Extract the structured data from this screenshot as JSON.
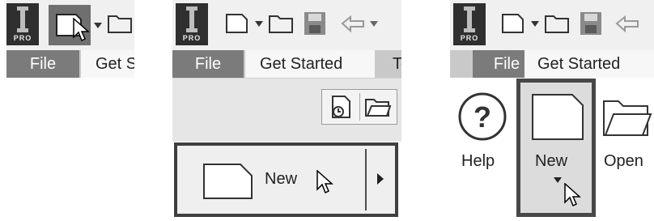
{
  "panel_zoomed": {
    "app_logo_text": "PRO",
    "tab_file": "File",
    "tab_get_started": "Get S"
  },
  "panel_ribbon": {
    "app_logo_text": "PRO",
    "tab_file": "File",
    "tab_get_started": "Get Started",
    "tab_next": "To",
    "new_button_label": "New"
  },
  "panel_get_started": {
    "app_logo_text": "PRO",
    "tab_file": "File",
    "tab_get_started": "Get Started",
    "help_label": "Help",
    "new_label": "New",
    "open_label": "Open"
  },
  "colors": {
    "file_tab_bg": "#7b7b7b",
    "highlight_border": "#3f3f3f",
    "tab_strip_bg": "#c9c9c9"
  },
  "icons": [
    "app-logo-icon",
    "new-document-icon",
    "dropdown-arrow-icon",
    "open-folder-icon",
    "save-icon",
    "undo-icon",
    "new-from-template-icon",
    "right-arrow-icon",
    "help-icon",
    "mouse-cursor-icon"
  ]
}
